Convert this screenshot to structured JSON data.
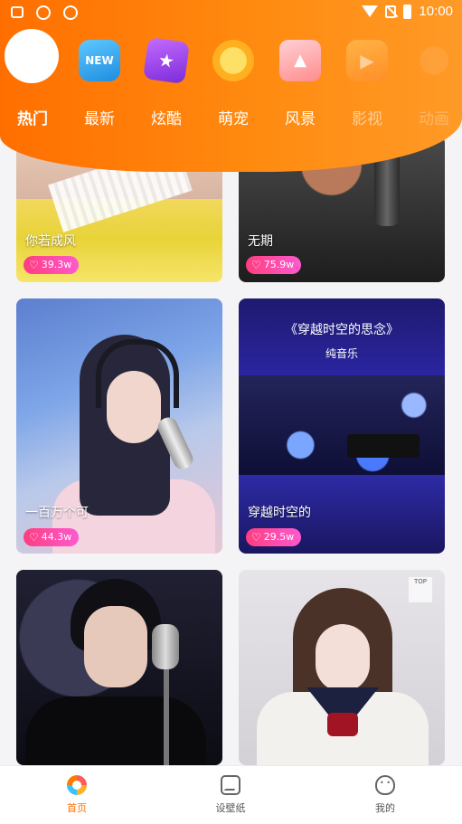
{
  "status": {
    "time": "10:00"
  },
  "categories": [
    {
      "label": "热门",
      "icon": "fire-icon",
      "active": true
    },
    {
      "label": "最新",
      "icon": "new-badge-icon",
      "badge": "NEW"
    },
    {
      "label": "炫酷",
      "icon": "star-icon"
    },
    {
      "label": "萌宠",
      "icon": "pet-icon"
    },
    {
      "label": "风景",
      "icon": "landscape-icon"
    },
    {
      "label": "影视",
      "icon": "film-icon"
    },
    {
      "label": "动画",
      "icon": "anime-icon"
    }
  ],
  "cards": [
    {
      "title": "你若成风",
      "likes": "39.3w"
    },
    {
      "title": "无期",
      "likes": "75.9w"
    },
    {
      "title": "一百万个可",
      "likes": "44.3w"
    },
    {
      "title": "穿越时空的",
      "likes": "29.5w",
      "overlay_title": "《穿越时空的思念》",
      "overlay_subtitle": "纯音乐"
    },
    {
      "title": "",
      "likes": ""
    },
    {
      "title": "",
      "likes": "",
      "tag": "TOP"
    }
  ],
  "bottom_nav": [
    {
      "label": "首页",
      "icon": "home-icon",
      "active": true
    },
    {
      "label": "设壁纸",
      "icon": "wallpaper-icon"
    },
    {
      "label": "我的",
      "icon": "profile-icon"
    }
  ],
  "colors": {
    "accent": "#ff6f00",
    "like_badge": "#ff3d7f"
  }
}
